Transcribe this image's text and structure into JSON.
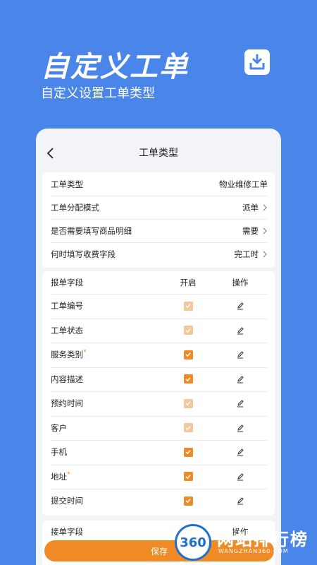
{
  "hero": {
    "title": "自定义工单",
    "subtitle": "自定义设置工单类型",
    "download_icon": "download-tray-icon"
  },
  "nav": {
    "title": "工单类型",
    "back_icon": "chevron-left-icon"
  },
  "settings": [
    {
      "label": "工单类型",
      "value": "物业维修工单",
      "chevron": false
    },
    {
      "label": "工单分配模式",
      "value": "派单",
      "chevron": true
    },
    {
      "label": "是否需要填写商品明细",
      "value": "需要",
      "chevron": true
    },
    {
      "label": "何时填写收费字段",
      "value": "完工时",
      "chevron": true
    }
  ],
  "report_fields": {
    "headers": {
      "name": "报单字段",
      "open": "开启",
      "op": "操作"
    },
    "rows": [
      {
        "name": "工单编号",
        "required": false,
        "checked": true,
        "locked": true
      },
      {
        "name": "工单状态",
        "required": false,
        "checked": true,
        "locked": true
      },
      {
        "name": "服务类别",
        "required": true,
        "checked": true,
        "locked": false
      },
      {
        "name": "内容描述",
        "required": false,
        "checked": true,
        "locked": false
      },
      {
        "name": "预约时间",
        "required": false,
        "checked": true,
        "locked": true
      },
      {
        "name": "客户",
        "required": false,
        "checked": true,
        "locked": true
      },
      {
        "name": "手机",
        "required": false,
        "checked": true,
        "locked": false
      },
      {
        "name": "地址",
        "required": true,
        "checked": true,
        "locked": false
      },
      {
        "name": "提交时间",
        "required": false,
        "checked": true,
        "locked": false
      }
    ]
  },
  "accept_fields": {
    "name": "接单字段",
    "op": "操作"
  },
  "save_label": "保存",
  "watermark": {
    "logo": "360",
    "text": "网站排行榜",
    "sub": "WANGZHAN360.COM"
  },
  "colors": {
    "background": "#4a86ea",
    "accent": "#f08a24",
    "accent_dim": "#f5c69a",
    "card": "#f2f4f8"
  }
}
